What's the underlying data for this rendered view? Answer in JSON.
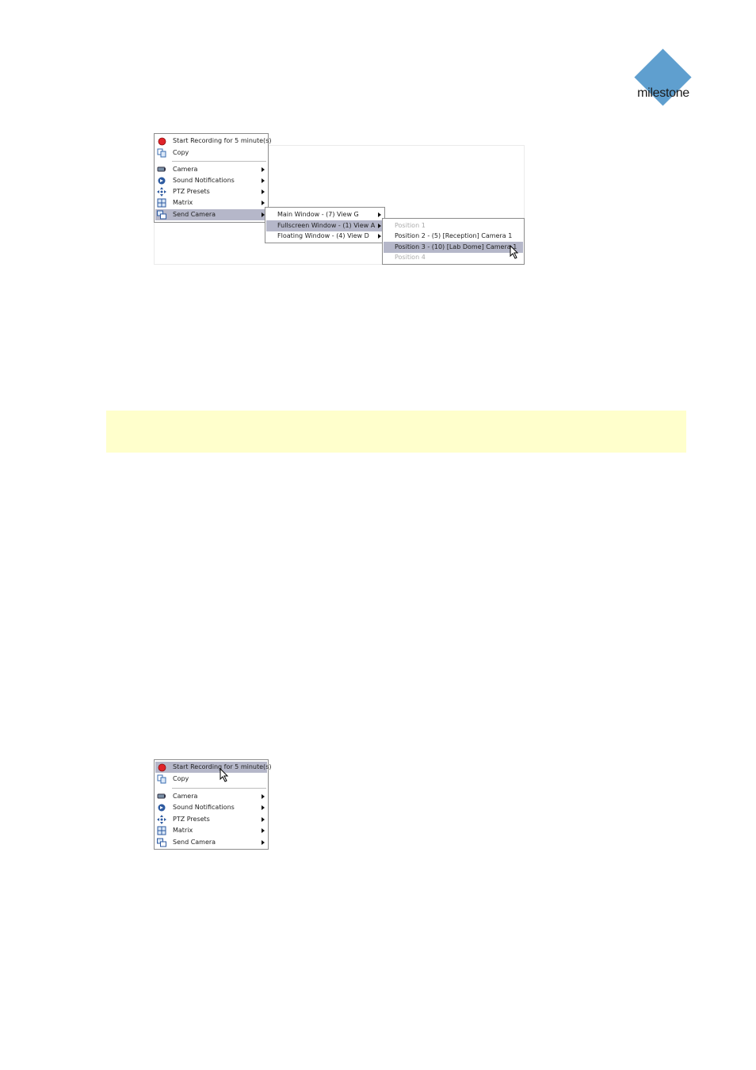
{
  "logo": {
    "text": "milestone",
    "color": "#5f9fcf"
  },
  "menu_top": {
    "items": [
      {
        "icon": "record-icon",
        "label": "Start Recording for 5 minute(s)"
      },
      {
        "icon": "copy-icon",
        "label": "Copy"
      },
      {
        "icon": "camera-icon",
        "label": "Camera"
      },
      {
        "icon": "sound-icon",
        "label": "Sound Notifications"
      },
      {
        "icon": "ptz-icon",
        "label": "PTZ Presets"
      },
      {
        "icon": "matrix-icon",
        "label": "Matrix"
      },
      {
        "icon": "send-camera-icon",
        "label": "Send Camera"
      }
    ],
    "highlighted": "Send Camera"
  },
  "submenu_windows": {
    "items": [
      {
        "label": "Main Window - (7) View G"
      },
      {
        "label": "Fullscreen Window - (1) View A"
      },
      {
        "label": "Floating Window - (4) View D"
      }
    ],
    "highlighted": "Fullscreen Window - (1) View A"
  },
  "submenu_positions": {
    "items": [
      {
        "label": "Position 1",
        "enabled": false
      },
      {
        "label": "Position 2 - (5) [Reception] Camera 1",
        "enabled": true
      },
      {
        "label": "Position 3 - (10) [Lab Dome] Camera 1",
        "enabled": true
      },
      {
        "label": "Position 4",
        "enabled": false
      }
    ],
    "highlighted": "Position 3 - (10) [Lab Dome] Camera 1"
  },
  "menu_bottom": {
    "items": [
      {
        "icon": "record-icon",
        "label": "Start Recording for 5 minute(s)"
      },
      {
        "icon": "copy-icon",
        "label": "Copy"
      },
      {
        "icon": "camera-icon",
        "label": "Camera"
      },
      {
        "icon": "sound-icon",
        "label": "Sound Notifications"
      },
      {
        "icon": "ptz-icon",
        "label": "PTZ Presets"
      },
      {
        "icon": "matrix-icon",
        "label": "Matrix"
      },
      {
        "icon": "send-camera-icon",
        "label": "Send Camera"
      }
    ],
    "highlighted": "Start Recording for 5 minute(s)"
  },
  "colors": {
    "highlight": "#b5b7c9",
    "note_background": "#ffffcc",
    "record": "#e0242a"
  }
}
